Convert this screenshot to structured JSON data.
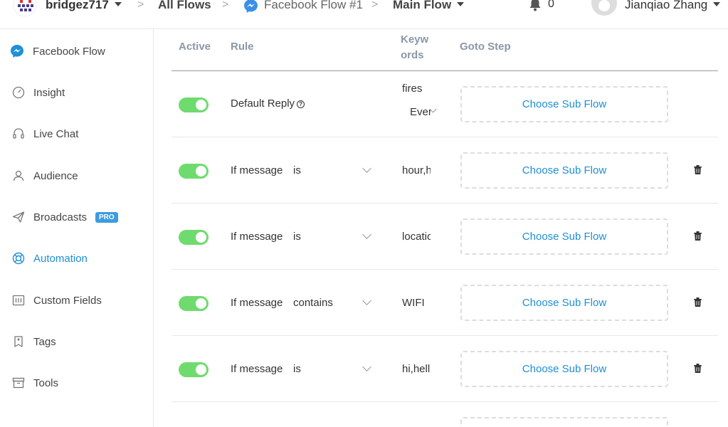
{
  "header": {
    "workspace": "bridgez717",
    "crumbs": [
      "All Flows",
      "Facebook Flow #1",
      "Main Flow"
    ],
    "notifications": "0",
    "user": "Jianqiao Zhang"
  },
  "sidebar": {
    "items": [
      {
        "label": "Facebook Flow",
        "icon": "messenger-icon"
      },
      {
        "label": "Insight",
        "icon": "insight-icon"
      },
      {
        "label": "Live Chat",
        "icon": "headset-icon"
      },
      {
        "label": "Audience",
        "icon": "user-icon"
      },
      {
        "label": "Broadcasts",
        "icon": "send-icon",
        "badge": "PRO"
      },
      {
        "label": "Automation",
        "icon": "lifebuoy-icon"
      },
      {
        "label": "Custom Fields",
        "icon": "fields-icon"
      },
      {
        "label": "Tags",
        "icon": "tag-icon"
      },
      {
        "label": "Tools",
        "icon": "archive-icon"
      }
    ],
    "active_index": 5
  },
  "table": {
    "headers": {
      "active": "Active",
      "rule": "Rule",
      "keywords": "Keywords",
      "goto": "Goto Step"
    },
    "rows": [
      {
        "rule": "Default Reply",
        "operator": "",
        "keyword": "fires",
        "keyword2": "Ever",
        "action": "Choose Sub Flow",
        "active": true
      },
      {
        "rule": "If message",
        "operator": "is",
        "keyword": "hour,h",
        "action": "Choose Sub Flow",
        "active": true
      },
      {
        "rule": "If message",
        "operator": "is",
        "keyword": "locatio",
        "action": "Choose Sub Flow",
        "active": true
      },
      {
        "rule": "If message",
        "operator": "contains",
        "keyword": "WIFI",
        "action": "Choose Sub Flow",
        "active": true
      },
      {
        "rule": "If message",
        "operator": "is",
        "keyword": "hi,hell",
        "action": "Choose Sub Flow",
        "active": true
      }
    ]
  },
  "colors": {
    "accent": "#1f8fd6",
    "toggle_on": "#6fdb6f",
    "pro_badge": "#3d9be0"
  }
}
